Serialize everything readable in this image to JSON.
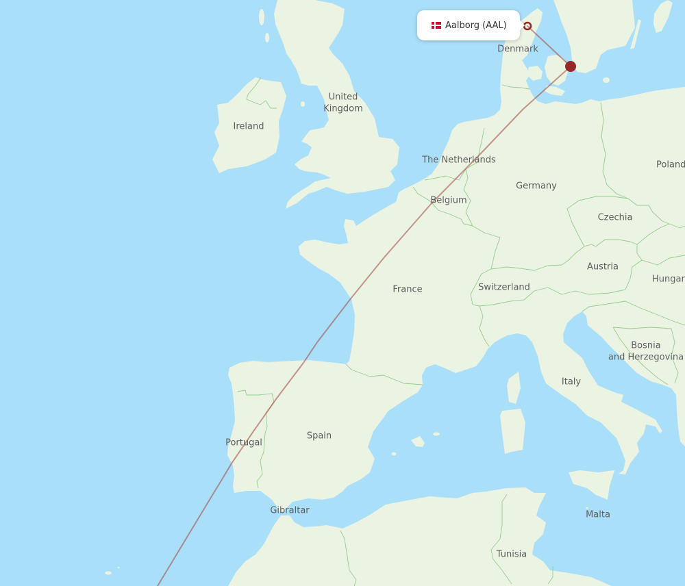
{
  "theme": {
    "water": "#aadff9",
    "land": "#ebf3e3",
    "border": "#95cc8e",
    "route": "#a0453f",
    "marker": "#952828",
    "label": "#5e5e5e"
  },
  "tooltip": {
    "flag_icon": "denmark-flag",
    "label": "Aalborg (AAL)"
  },
  "icons": {
    "origin_marker": "airport-ring-marker",
    "stop_marker": "airport-dot-marker"
  },
  "labels": {
    "ireland": "Ireland",
    "uk_line1": "United",
    "uk_line2": "Kingdom",
    "denmark": "Denmark",
    "netherlands": "The Netherlands",
    "germany": "Germany",
    "belgium": "Belgium",
    "poland": "Poland",
    "czechia": "Czechia",
    "austria": "Austria",
    "hungary": "Hungary",
    "france": "France",
    "switzerland": "Switzerland",
    "bosnia_line1": "Bosnia",
    "bosnia_line2": "and Herzegovina",
    "italy": "Italy",
    "spain": "Spain",
    "portugal": "Portugal",
    "gibraltar": "Gibraltar",
    "malta": "Malta",
    "tunisia": "Tunisia"
  }
}
